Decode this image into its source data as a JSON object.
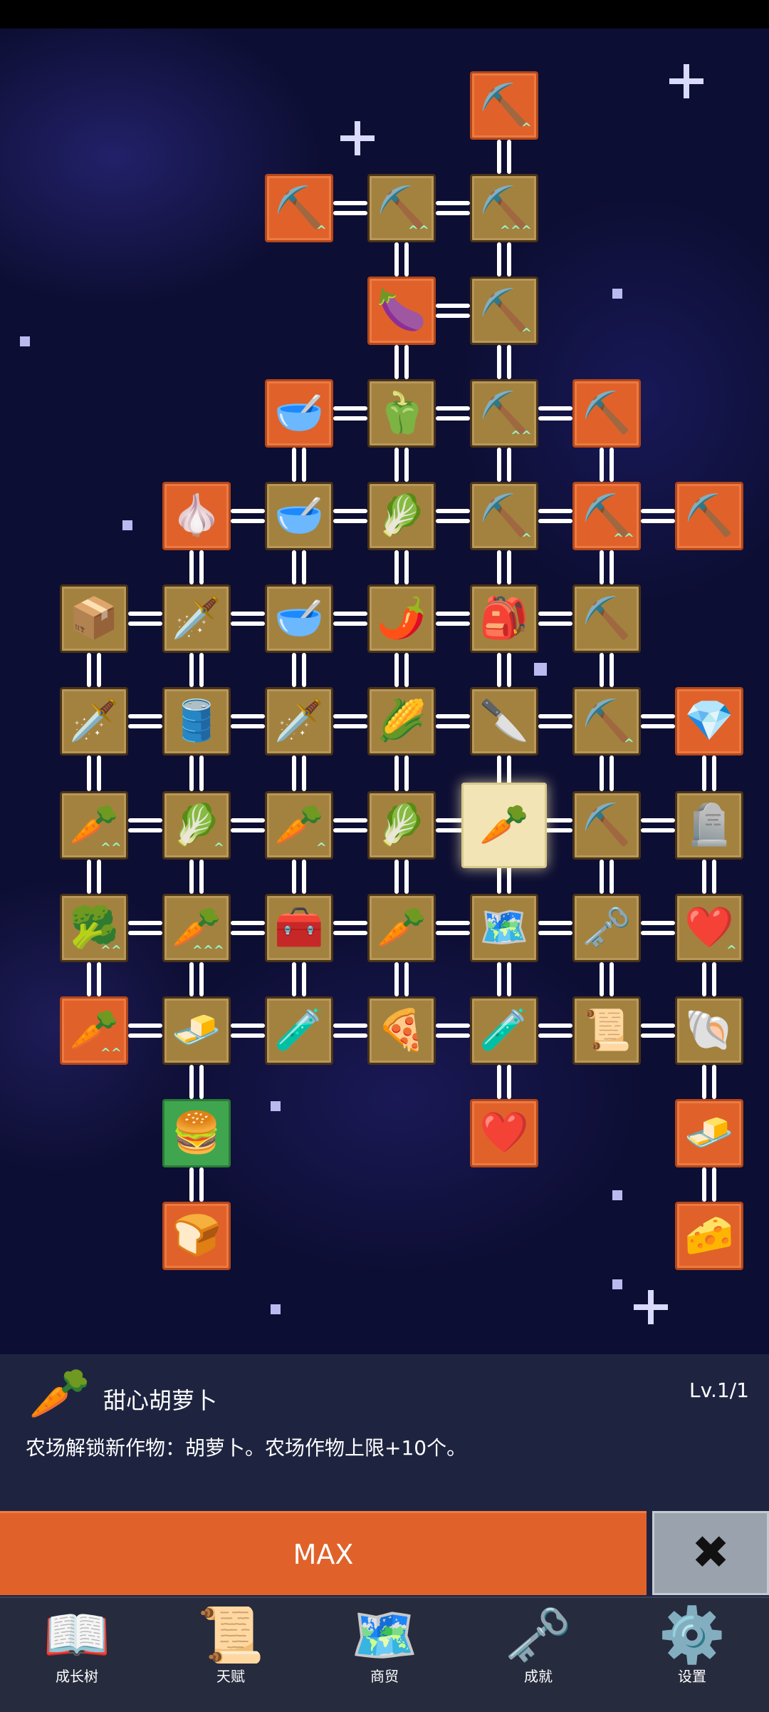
{
  "tree_nodes": [
    {
      "col": 4,
      "row": 0,
      "style": "orange",
      "icon": "shovel-icon",
      "glyph": "⛏️",
      "up": "^"
    },
    {
      "col": 2,
      "row": 1,
      "style": "orange",
      "icon": "shovel-icon",
      "glyph": "⛏️",
      "up": "^"
    },
    {
      "col": 3,
      "row": 1,
      "style": "brown",
      "icon": "shovel-frame-icon",
      "glyph": "⛏️",
      "up": "^^"
    },
    {
      "col": 4,
      "row": 1,
      "style": "brown",
      "icon": "shovel-icon",
      "glyph": "⛏️",
      "up": "^^^"
    },
    {
      "col": 3,
      "row": 2,
      "style": "orange",
      "icon": "eggplant-icon",
      "glyph": "🍆",
      "up": ""
    },
    {
      "col": 4,
      "row": 2,
      "style": "brown",
      "icon": "shovel-frame-icon",
      "glyph": "⛏️",
      "up": "^"
    },
    {
      "col": 2,
      "row": 3,
      "style": "orange",
      "icon": "bowl-icon",
      "glyph": "🥣",
      "up": ""
    },
    {
      "col": 3,
      "row": 3,
      "style": "brown",
      "icon": "pepper-icon",
      "glyph": "🫑",
      "up": ""
    },
    {
      "col": 4,
      "row": 3,
      "style": "brown",
      "icon": "shovel-icon",
      "glyph": "⛏️",
      "up": "^^"
    },
    {
      "col": 5,
      "row": 3,
      "style": "orange",
      "icon": "pickaxe-icon",
      "glyph": "⛏️",
      "up": ""
    },
    {
      "col": 1,
      "row": 4,
      "style": "orange",
      "icon": "garlic-icon",
      "glyph": "🧄",
      "up": ""
    },
    {
      "col": 2,
      "row": 4,
      "style": "brown",
      "icon": "soup-bowl-icon",
      "glyph": "🥣",
      "up": ""
    },
    {
      "col": 3,
      "row": 4,
      "style": "brown",
      "icon": "radish-icon",
      "glyph": "🥬",
      "up": ""
    },
    {
      "col": 4,
      "row": 4,
      "style": "brown",
      "icon": "shovel-icon",
      "glyph": "⛏️",
      "up": "^"
    },
    {
      "col": 5,
      "row": 4,
      "style": "orange",
      "icon": "pickaxe-icon",
      "glyph": "⛏️",
      "up": "^^"
    },
    {
      "col": 6,
      "row": 4,
      "style": "orange",
      "icon": "pickaxe-icon",
      "glyph": "⛏️",
      "up": ""
    },
    {
      "col": 0,
      "row": 5,
      "style": "brown",
      "icon": "wooden-crate-icon",
      "glyph": "📦",
      "up": ""
    },
    {
      "col": 1,
      "row": 5,
      "style": "brown",
      "icon": "sword-icon",
      "glyph": "🗡️",
      "up": ""
    },
    {
      "col": 2,
      "row": 5,
      "style": "brown",
      "icon": "bowl-icon",
      "glyph": "🥣",
      "up": ""
    },
    {
      "col": 3,
      "row": 5,
      "style": "brown",
      "icon": "chili-pepper-icon",
      "glyph": "🌶️",
      "up": ""
    },
    {
      "col": 4,
      "row": 5,
      "style": "brown",
      "icon": "backpack-icon",
      "glyph": "🎒",
      "up": ""
    },
    {
      "col": 5,
      "row": 5,
      "style": "brown",
      "icon": "pickaxe-icon",
      "glyph": "⛏️",
      "up": ""
    },
    {
      "col": 0,
      "row": 6,
      "style": "brown",
      "icon": "sword-icon",
      "glyph": "🗡️",
      "up": ""
    },
    {
      "col": 1,
      "row": 6,
      "style": "brown",
      "icon": "barrel-icon",
      "glyph": "🛢️",
      "up": ""
    },
    {
      "col": 2,
      "row": 6,
      "style": "brown",
      "icon": "sword-icon",
      "glyph": "🗡️",
      "up": ""
    },
    {
      "col": 3,
      "row": 6,
      "style": "brown",
      "icon": "corn-icon",
      "glyph": "🌽",
      "up": ""
    },
    {
      "col": 4,
      "row": 6,
      "style": "brown",
      "icon": "dagger-icon",
      "glyph": "🔪",
      "up": ""
    },
    {
      "col": 5,
      "row": 6,
      "style": "brown",
      "icon": "pickaxe-icon",
      "glyph": "⛏️",
      "up": "^"
    },
    {
      "col": 6,
      "row": 6,
      "style": "orange",
      "icon": "crystal-icon",
      "glyph": "💎",
      "up": ""
    },
    {
      "col": 0,
      "row": 7,
      "style": "brown",
      "icon": "carrot-frame-icon",
      "glyph": "🥕",
      "up": "^^"
    },
    {
      "col": 1,
      "row": 7,
      "style": "brown",
      "icon": "cabbage-icon",
      "glyph": "🥬",
      "up": "^"
    },
    {
      "col": 2,
      "row": 7,
      "style": "brown",
      "icon": "carrot-frame-icon",
      "glyph": "🥕",
      "up": "^"
    },
    {
      "col": 3,
      "row": 7,
      "style": "brown",
      "icon": "cabbage-icon",
      "glyph": "🥬",
      "up": ""
    },
    {
      "col": 4,
      "row": 7,
      "style": "selected",
      "icon": "carrot-icon",
      "glyph": "🥕",
      "up": ""
    },
    {
      "col": 5,
      "row": 7,
      "style": "brown",
      "icon": "pickaxe-icon",
      "glyph": "⛏️",
      "up": ""
    },
    {
      "col": 6,
      "row": 7,
      "style": "brown",
      "icon": "tombstone-icon",
      "glyph": "🪦",
      "up": ""
    },
    {
      "col": 0,
      "row": 8,
      "style": "brown",
      "icon": "broccoli-icon",
      "glyph": "🥦",
      "up": "^^"
    },
    {
      "col": 1,
      "row": 8,
      "style": "brown",
      "icon": "carrot-frame-icon",
      "glyph": "🥕",
      "up": "^^^"
    },
    {
      "col": 2,
      "row": 8,
      "style": "brown",
      "icon": "treasure-chest-icon",
      "glyph": "🧰",
      "up": ""
    },
    {
      "col": 3,
      "row": 8,
      "style": "brown",
      "icon": "parsnip-icon",
      "glyph": "🥕",
      "up": ""
    },
    {
      "col": 4,
      "row": 8,
      "style": "brown",
      "icon": "map-icon",
      "glyph": "🗺️",
      "up": ""
    },
    {
      "col": 5,
      "row": 8,
      "style": "brown",
      "icon": "key-icon",
      "glyph": "🗝️",
      "up": ""
    },
    {
      "col": 6,
      "row": 8,
      "style": "brown",
      "icon": "heart-icon",
      "glyph": "❤️",
      "up": "^"
    },
    {
      "col": 0,
      "row": 9,
      "style": "orange",
      "icon": "carrot-frame-icon",
      "glyph": "🥕",
      "up": "^^"
    },
    {
      "col": 1,
      "row": 9,
      "style": "brown",
      "icon": "gold-bar-icon",
      "glyph": "🧈",
      "up": ""
    },
    {
      "col": 2,
      "row": 9,
      "style": "brown",
      "icon": "potion-icon",
      "glyph": "🧪",
      "up": ""
    },
    {
      "col": 3,
      "row": 9,
      "style": "brown",
      "icon": "pizza-icon",
      "glyph": "🍕",
      "up": ""
    },
    {
      "col": 4,
      "row": 9,
      "style": "brown",
      "icon": "potion-icon",
      "glyph": "🧪",
      "up": ""
    },
    {
      "col": 5,
      "row": 9,
      "style": "brown",
      "icon": "scroll-icon",
      "glyph": "📜",
      "up": ""
    },
    {
      "col": 6,
      "row": 9,
      "style": "brown",
      "icon": "fossil-icon",
      "glyph": "🐚",
      "up": ""
    },
    {
      "col": 1,
      "row": 10,
      "style": "green",
      "icon": "burger-icon",
      "glyph": "🍔",
      "up": ""
    },
    {
      "col": 4,
      "row": 10,
      "style": "orange",
      "icon": "heart-icon",
      "glyph": "❤️",
      "up": ""
    },
    {
      "col": 6,
      "row": 10,
      "style": "orange",
      "icon": "butter-icon",
      "glyph": "🧈",
      "up": ""
    },
    {
      "col": 1,
      "row": 11,
      "style": "orange",
      "icon": "bread-frame-icon",
      "glyph": "🍞",
      "up": ""
    },
    {
      "col": 6,
      "row": 11,
      "style": "orange",
      "icon": "cheese-icon",
      "glyph": "🧀",
      "up": ""
    }
  ],
  "detail_panel": {
    "icon": "carrot-icon",
    "glyph": "🥕",
    "name": "甜心胡萝卜",
    "level": "Lv.1/1",
    "description": "农场解锁新作物：胡萝卜。农场作物上限+10个。"
  },
  "actions": {
    "max_label": "MAX",
    "close_glyph": "✖"
  },
  "bottom_nav": [
    {
      "label": "成长树",
      "icon": "book-icon",
      "glyph": "📖"
    },
    {
      "label": "天赋",
      "icon": "scroll-icon",
      "glyph": "📜"
    },
    {
      "label": "商贸",
      "icon": "map-icon",
      "glyph": "🗺️"
    },
    {
      "label": "成就",
      "icon": "key-icon",
      "glyph": "🗝️"
    },
    {
      "label": "设置",
      "icon": "gear-icon",
      "glyph": "⚙️"
    }
  ],
  "colors": {
    "orange": "#e0622a",
    "brown": "#a3823f",
    "green": "#3fa64f",
    "panel": "#1e2440",
    "nav": "#262b3d"
  }
}
